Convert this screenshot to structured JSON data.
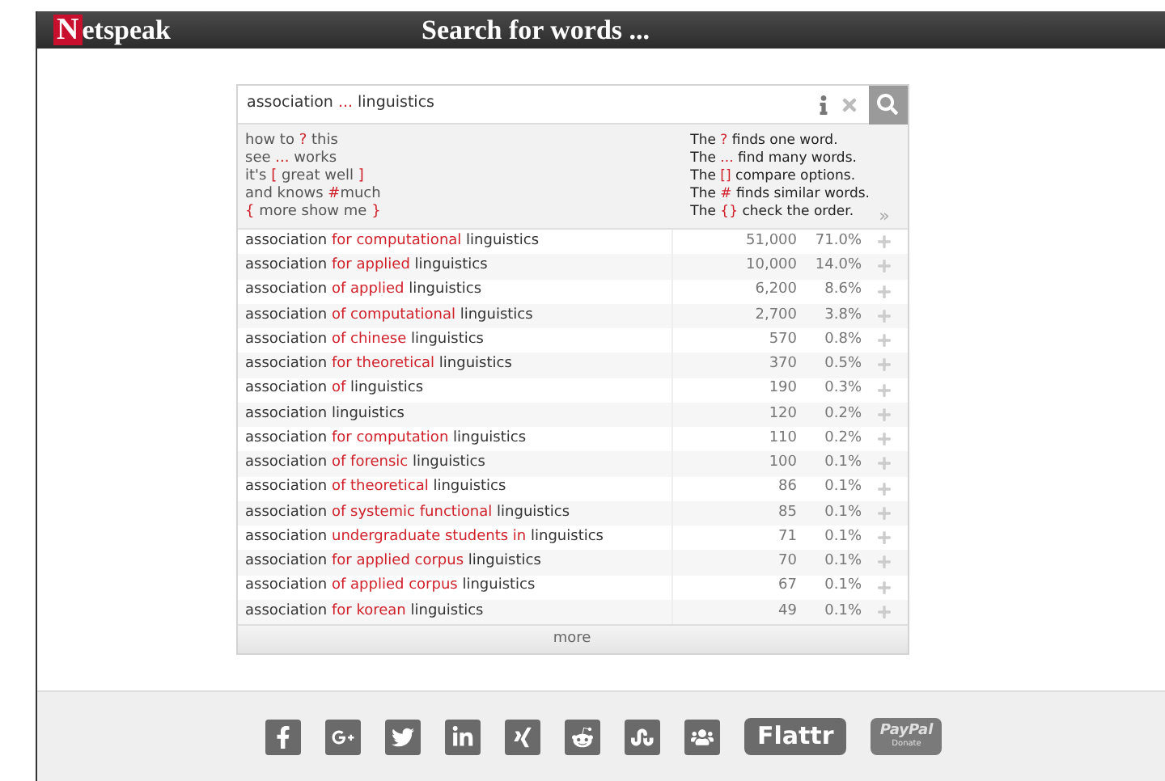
{
  "header": {
    "logo": {
      "initial": "N",
      "rest": "etspeak"
    },
    "title": "Search for words ..."
  },
  "search": {
    "query": [
      {
        "text": "association ",
        "kind": "plain"
      },
      {
        "text": "...",
        "kind": "operator"
      },
      {
        "text": " linguistics",
        "kind": "plain"
      }
    ]
  },
  "hints": {
    "examples": [
      [
        {
          "text": "how to ",
          "kind": "plain"
        },
        {
          "text": "?",
          "kind": "operator"
        },
        {
          "text": " this",
          "kind": "plain"
        }
      ],
      [
        {
          "text": "see ",
          "kind": "plain"
        },
        {
          "text": "...",
          "kind": "operator"
        },
        {
          "text": " works",
          "kind": "plain"
        }
      ],
      [
        {
          "text": "it's ",
          "kind": "plain"
        },
        {
          "text": "[",
          "kind": "operator"
        },
        {
          "text": " great well ",
          "kind": "plain"
        },
        {
          "text": "]",
          "kind": "operator"
        }
      ],
      [
        {
          "text": "and knows ",
          "kind": "plain"
        },
        {
          "text": "#",
          "kind": "operator"
        },
        {
          "text": "much",
          "kind": "plain"
        }
      ],
      [
        {
          "text": "{",
          "kind": "operator"
        },
        {
          "text": " more show me ",
          "kind": "plain"
        },
        {
          "text": "}",
          "kind": "operator"
        }
      ]
    ],
    "explanations": [
      [
        {
          "text": "The ",
          "kind": "plain"
        },
        {
          "text": "?",
          "kind": "operator"
        },
        {
          "text": " finds one word.",
          "kind": "plain"
        }
      ],
      [
        {
          "text": "The ",
          "kind": "plain"
        },
        {
          "text": "...",
          "kind": "operator"
        },
        {
          "text": " find many words.",
          "kind": "plain"
        }
      ],
      [
        {
          "text": "The ",
          "kind": "plain"
        },
        {
          "text": "[]",
          "kind": "operator"
        },
        {
          "text": " compare options.",
          "kind": "plain"
        }
      ],
      [
        {
          "text": "The ",
          "kind": "plain"
        },
        {
          "text": "#",
          "kind": "operator"
        },
        {
          "text": " finds similar words.",
          "kind": "plain"
        }
      ],
      [
        {
          "text": "The ",
          "kind": "plain"
        },
        {
          "text": "{}",
          "kind": "operator"
        },
        {
          "text": " check the order.",
          "kind": "plain"
        }
      ]
    ],
    "expand": "»"
  },
  "results": [
    {
      "before": "association",
      "match": "for computational",
      "after": "linguistics",
      "count": "51,000",
      "percent": "71.0%"
    },
    {
      "before": "association",
      "match": "for applied",
      "after": "linguistics",
      "count": "10,000",
      "percent": "14.0%"
    },
    {
      "before": "association",
      "match": "of applied",
      "after": "linguistics",
      "count": "6,200",
      "percent": "8.6%"
    },
    {
      "before": "association",
      "match": "of computational",
      "after": "linguistics",
      "count": "2,700",
      "percent": "3.8%"
    },
    {
      "before": "association",
      "match": "of chinese",
      "after": "linguistics",
      "count": "570",
      "percent": "0.8%"
    },
    {
      "before": "association",
      "match": "for theoretical",
      "after": "linguistics",
      "count": "370",
      "percent": "0.5%"
    },
    {
      "before": "association",
      "match": "of",
      "after": "linguistics",
      "count": "190",
      "percent": "0.3%"
    },
    {
      "before": "association",
      "after": "linguistics",
      "count": "120",
      "percent": "0.2%"
    },
    {
      "before": "association",
      "match": "for computation",
      "after": "linguistics",
      "count": "110",
      "percent": "0.2%"
    },
    {
      "before": "association",
      "match": "of forensic",
      "after": "linguistics",
      "count": "100",
      "percent": "0.1%"
    },
    {
      "before": "association",
      "match": "of theoretical",
      "after": "linguistics",
      "count": "86",
      "percent": "0.1%"
    },
    {
      "before": "association",
      "match": "of systemic functional",
      "after": "linguistics",
      "count": "85",
      "percent": "0.1%"
    },
    {
      "before": "association",
      "match": "undergraduate students in",
      "after": "linguistics",
      "count": "71",
      "percent": "0.1%"
    },
    {
      "before": "association",
      "match": "for applied corpus",
      "after": "linguistics",
      "count": "70",
      "percent": "0.1%"
    },
    {
      "before": "association",
      "match": "of applied corpus",
      "after": "linguistics",
      "count": "67",
      "percent": "0.1%"
    },
    {
      "before": "association",
      "match": "for korean",
      "after": "linguistics",
      "count": "49",
      "percent": "0.1%"
    }
  ],
  "more": "more",
  "footer": [
    {
      "kind": "facebook"
    },
    {
      "kind": "googleplus"
    },
    {
      "kind": "twitter"
    },
    {
      "kind": "linkedin"
    },
    {
      "kind": "xing"
    },
    {
      "kind": "reddit"
    },
    {
      "kind": "stumbleupon"
    },
    {
      "kind": "people"
    },
    {
      "kind": "flattr",
      "label": "Flattr"
    },
    {
      "kind": "paypal",
      "label": "PayPal",
      "sublabel": "Donate"
    }
  ]
}
